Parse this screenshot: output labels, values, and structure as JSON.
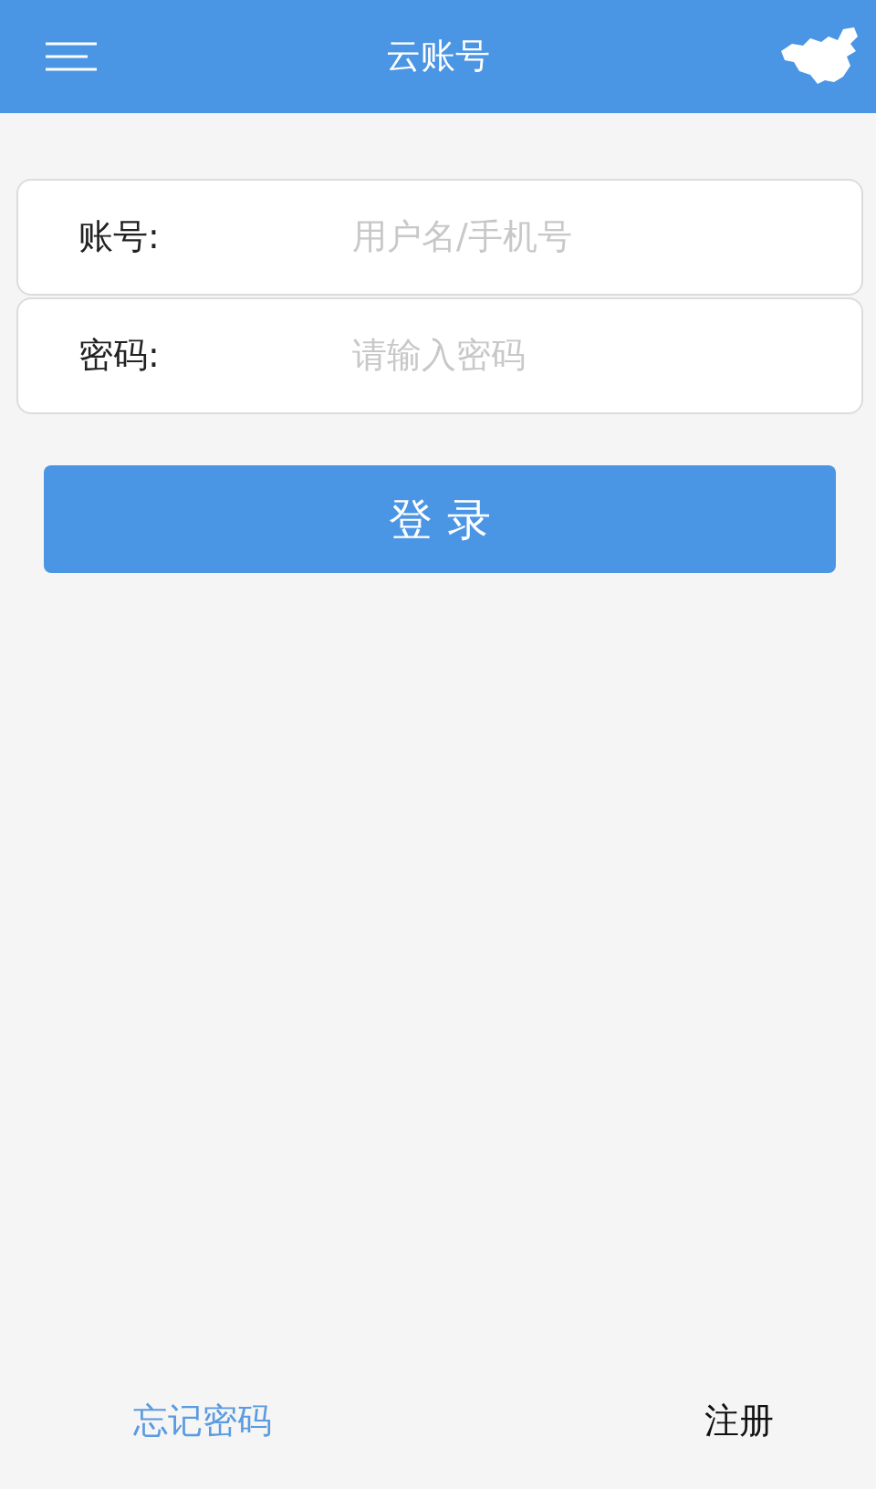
{
  "header": {
    "title": "云账号"
  },
  "fields": [
    {
      "label": "账号:",
      "placeholder": "用户名/手机号"
    },
    {
      "label": "密码:",
      "placeholder": "请输入密码"
    }
  ],
  "login_button": "登 录",
  "footer": {
    "forgot_link": "忘记密码",
    "register_link": "注册"
  }
}
